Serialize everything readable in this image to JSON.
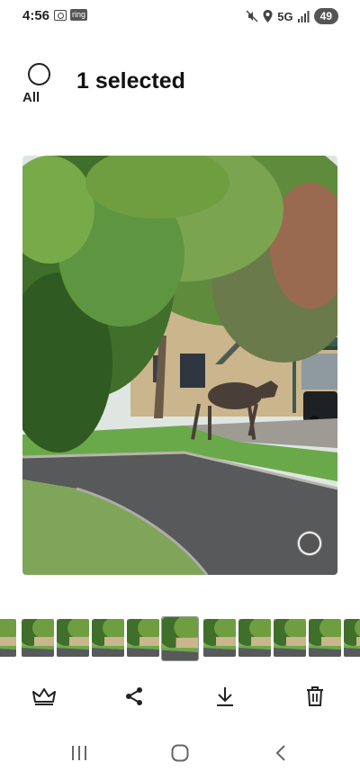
{
  "status_bar": {
    "time": "4:56",
    "ring_label": "ring",
    "network": "5G",
    "battery": "49",
    "icons": [
      "screenshot-icon",
      "ring-app-icon",
      "mute-icon",
      "location-icon",
      "signal-icon"
    ]
  },
  "header": {
    "select_all_label": "All",
    "title": "1 selected"
  },
  "photo": {
    "subject": "moose-photo",
    "motion_icon": "motion-photo-icon"
  },
  "filmstrip": {
    "thumbnail_count": 10,
    "selected_index": 4
  },
  "actions": [
    {
      "name": "crown-icon"
    },
    {
      "name": "share-icon"
    },
    {
      "name": "download-icon"
    },
    {
      "name": "delete-icon"
    }
  ],
  "nav": [
    "recent-apps-icon",
    "home-icon",
    "back-icon"
  ]
}
